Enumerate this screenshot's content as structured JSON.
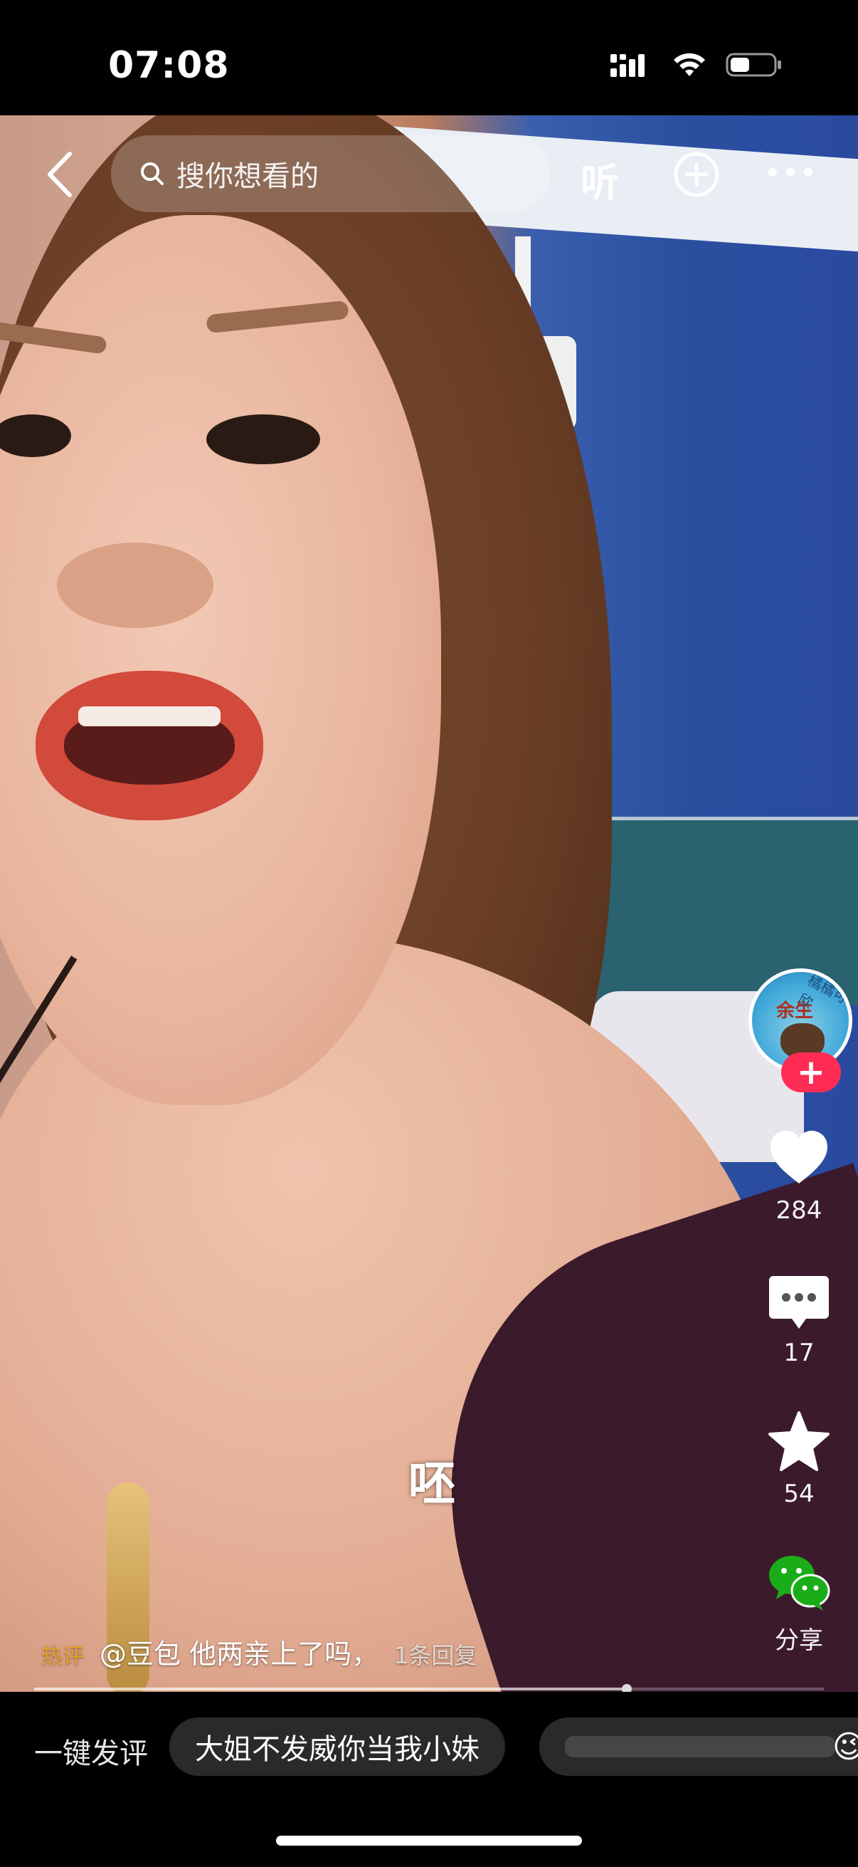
{
  "status_bar": {
    "time": "07:08",
    "icons": [
      "cellular-signal-icon",
      "wifi-icon",
      "battery-icon"
    ]
  },
  "top_nav": {
    "search_placeholder": "搜你想看的",
    "listen_label": "听",
    "icons": [
      "back-arrow-icon",
      "search-icon",
      "add-circle-icon",
      "more-dots-icon"
    ]
  },
  "video": {
    "caption": "呸"
  },
  "actions": {
    "avatar_text": "余生",
    "avatar_badge": "橘橘可欣",
    "follow_label": "+",
    "like_count": "284",
    "comment_count": "17",
    "favorite_count": "54",
    "share_label": "分享",
    "colors": {
      "follow": "#fe2c55",
      "share": "#1aad19"
    }
  },
  "hot_comment": {
    "tag": "热评",
    "text": "@豆包 他两亲上了吗，",
    "reply": "1条回复"
  },
  "progress": {
    "value_fraction": 0.75
  },
  "bottom_bar": {
    "label": "一键发评",
    "chips": [
      "大姐不发威你当我小妹"
    ],
    "second_chip_emoji": "😉"
  }
}
